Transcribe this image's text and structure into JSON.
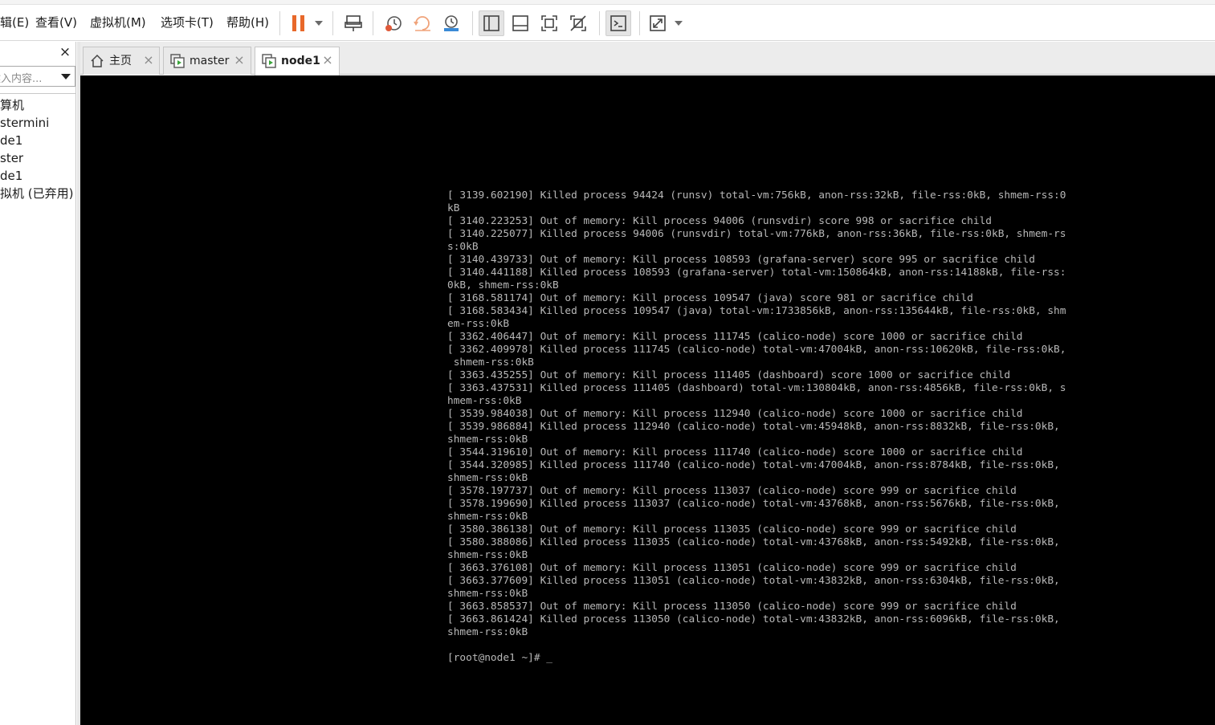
{
  "menu": {
    "items": [
      "辑(E)",
      "查看(V)",
      "虚拟机(M)",
      "选项卡(T)",
      "帮助(H)"
    ]
  },
  "toolbar": {
    "icons": [
      "pause-icon",
      "send-keys-icon",
      "snapshot-icon",
      "revert-snapshot-icon",
      "snapshot-manager-icon",
      "show-library-icon",
      "thumbnail-bar-icon",
      "full-screen-icon",
      "unity-icon",
      "console-view-icon",
      "stretch-icon"
    ],
    "pause_color": "#e8682a"
  },
  "library": {
    "close_glyph": "×",
    "search_placeholder": "键入内容...",
    "items": [
      "算机",
      "stermini",
      "de1",
      "ster",
      "de1",
      "拟机 (已弃用)"
    ]
  },
  "tabs": [
    {
      "label": "主页",
      "icon": "home-icon",
      "active": false
    },
    {
      "label": "master",
      "icon": "vm-icon",
      "active": false
    },
    {
      "label": "node1",
      "icon": "vm-icon",
      "active": true
    }
  ],
  "console": {
    "background": "#000000",
    "text_color": "#b8b8b8",
    "lines": [
      "[ 3139.602190] Killed process 94424 (runsv) total-vm:756kB, anon-rss:32kB, file-rss:0kB, shmem-rss:0",
      "kB",
      "[ 3140.223253] Out of memory: Kill process 94006 (runsvdir) score 998 or sacrifice child",
      "[ 3140.225077] Killed process 94006 (runsvdir) total-vm:776kB, anon-rss:36kB, file-rss:0kB, shmem-rs",
      "s:0kB",
      "[ 3140.439733] Out of memory: Kill process 108593 (grafana-server) score 995 or sacrifice child",
      "[ 3140.441188] Killed process 108593 (grafana-server) total-vm:150864kB, anon-rss:14188kB, file-rss:",
      "0kB, shmem-rss:0kB",
      "[ 3168.581174] Out of memory: Kill process 109547 (java) score 981 or sacrifice child",
      "[ 3168.583434] Killed process 109547 (java) total-vm:1733856kB, anon-rss:135644kB, file-rss:0kB, shm",
      "em-rss:0kB",
      "[ 3362.406447] Out of memory: Kill process 111745 (calico-node) score 1000 or sacrifice child",
      "[ 3362.409978] Killed process 111745 (calico-node) total-vm:47004kB, anon-rss:10620kB, file-rss:0kB,",
      " shmem-rss:0kB",
      "[ 3363.435255] Out of memory: Kill process 111405 (dashboard) score 1000 or sacrifice child",
      "[ 3363.437531] Killed process 111405 (dashboard) total-vm:130804kB, anon-rss:4856kB, file-rss:0kB, s",
      "hmem-rss:0kB",
      "[ 3539.984038] Out of memory: Kill process 112940 (calico-node) score 1000 or sacrifice child",
      "[ 3539.986884] Killed process 112940 (calico-node) total-vm:45948kB, anon-rss:8832kB, file-rss:0kB,",
      "shmem-rss:0kB",
      "[ 3544.319610] Out of memory: Kill process 111740 (calico-node) score 1000 or sacrifice child",
      "[ 3544.320985] Killed process 111740 (calico-node) total-vm:47004kB, anon-rss:8784kB, file-rss:0kB,",
      "shmem-rss:0kB",
      "[ 3578.197737] Out of memory: Kill process 113037 (calico-node) score 999 or sacrifice child",
      "[ 3578.199690] Killed process 113037 (calico-node) total-vm:43768kB, anon-rss:5676kB, file-rss:0kB,",
      "shmem-rss:0kB",
      "[ 3580.386138] Out of memory: Kill process 113035 (calico-node) score 999 or sacrifice child",
      "[ 3580.388086] Killed process 113035 (calico-node) total-vm:43768kB, anon-rss:5492kB, file-rss:0kB,",
      "shmem-rss:0kB",
      "[ 3663.376108] Out of memory: Kill process 113051 (calico-node) score 999 or sacrifice child",
      "[ 3663.377609] Killed process 113051 (calico-node) total-vm:43832kB, anon-rss:6304kB, file-rss:0kB,",
      "shmem-rss:0kB",
      "[ 3663.858537] Out of memory: Kill process 113050 (calico-node) score 999 or sacrifice child",
      "[ 3663.861424] Killed process 113050 (calico-node) total-vm:43832kB, anon-rss:6096kB, file-rss:0kB,",
      "shmem-rss:0kB",
      "",
      "[root@node1 ~]# _"
    ]
  }
}
